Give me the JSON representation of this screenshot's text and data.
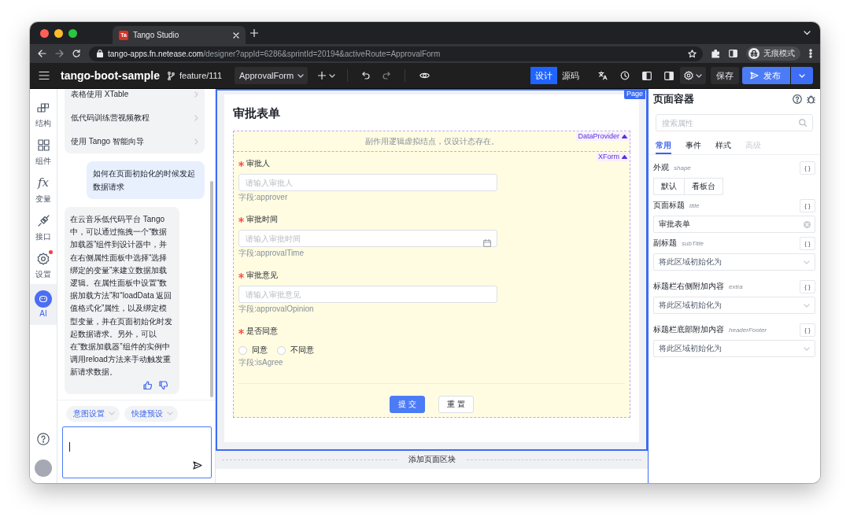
{
  "browser": {
    "favicon": "Ta",
    "tab_title": "Tango Studio",
    "url": "**tango-apps.fn.netease.com**/designer?appId=6286&sprintId=20194&activeRoute=ApprovalForm",
    "profile_label": "无痕模式"
  },
  "toolbar": {
    "project": "tango-boot-sample",
    "branch": "feature/111",
    "route": "ApprovalForm",
    "modes": [
      {
        "label": "设计",
        "selected": true
      },
      {
        "label": "源码",
        "selected": false
      }
    ],
    "save": "保存",
    "publish": "发布"
  },
  "rail": {
    "items": [
      {
        "kind": "structure",
        "label": "结构",
        "selected": false,
        "badge": false
      },
      {
        "kind": "components",
        "label": "组件",
        "selected": false,
        "badge": false
      },
      {
        "kind": "variables",
        "glyph": "fx",
        "label": "变量",
        "selected": false,
        "badge": false
      },
      {
        "kind": "api",
        "label": "接口",
        "selected": false,
        "badge": false
      },
      {
        "kind": "settings",
        "label": "设置",
        "selected": false,
        "badge": true
      },
      {
        "kind": "ai",
        "label": "AI",
        "selected": true,
        "badge": false
      }
    ]
  },
  "chat": {
    "guides": [
      {
        "label": "表格使用 XTable"
      },
      {
        "label": "低代码训练营视频教程"
      },
      {
        "label": "使用 Tango 智能向导"
      }
    ],
    "messages": [
      {
        "kind": "user",
        "text": "如何在页面初始化的时候发起数据请求"
      },
      {
        "kind": "assistant",
        "text": "在云音乐低代码平台 Tango 中，可以通过拖拽一个“数据加载器”组件到设计器中，并在右侧属性面板中选择“选择绑定的变量”来建立数据加载逻辑。在属性面板中设置“数据加载方法”和“loadData 返回值格式化”属性，以及绑定模型变量，并在页面初始化时发起数据请求。另外，可以在“数据加载器”组件的实例中调用reload方法来手动触发重新请求数据。"
      }
    ],
    "chips": [
      "意图设置",
      "快捷预设"
    ]
  },
  "canvas": {
    "page_tag": "Page",
    "title": "审批表单",
    "data_provider": {
      "tag": "DataProvider",
      "text": "副作用逻辑虚拟结点，仅设计态存在。"
    },
    "form": {
      "tag": "XForm",
      "fields": [
        {
          "kind": "input",
          "label": "审批人",
          "required": true,
          "placeholder": "请输入审批人",
          "hint": "字段:approver"
        },
        {
          "kind": "date",
          "label": "审批时间",
          "required": true,
          "placeholder": "请输入审批时间",
          "hint": "字段:approvalTime"
        },
        {
          "kind": "input",
          "label": "审批意见",
          "required": true,
          "placeholder": "请输入审批意见",
          "hint": "字段:approvalOpinion"
        },
        {
          "kind": "radio",
          "label": "是否同意",
          "required": true,
          "options": [
            {
              "label": "同意",
              "selected": false
            },
            {
              "label": "不同意",
              "selected": false
            }
          ],
          "hint": "字段:isAgree"
        }
      ],
      "buttons": [
        {
          "kind": "primary",
          "label": "提 交"
        },
        {
          "kind": "default",
          "label": "重 置"
        }
      ]
    },
    "add_block": "添加页面区块"
  },
  "inspector": {
    "title": "页面容器",
    "search_placeholder": "搜索属性",
    "tabs": [
      {
        "label": "常用",
        "selected": true,
        "disabled": false
      },
      {
        "label": "事件",
        "selected": false,
        "disabled": false
      },
      {
        "label": "样式",
        "selected": false,
        "disabled": false
      },
      {
        "label": "高级",
        "selected": false,
        "disabled": true
      }
    ],
    "props": [
      {
        "kind": "segmented",
        "label": "外观",
        "key": "shape",
        "binding": "{ }",
        "options": [
          {
            "label": "默认",
            "selected": false
          },
          {
            "label": "看板台",
            "selected": false
          }
        ]
      },
      {
        "kind": "input",
        "label": "页面标题",
        "key": "title",
        "binding": "{ }",
        "value": "审批表单"
      },
      {
        "kind": "select",
        "label": "副标题",
        "key": "subTitle",
        "binding": "{ }",
        "value": "将此区域初始化为"
      },
      {
        "kind": "select",
        "label": "标题栏右侧附加内容",
        "key": "extra",
        "binding": "{ }",
        "value": "将此区域初始化为"
      },
      {
        "kind": "select",
        "label": "标题栏底部附加内容",
        "key": "headerFooter",
        "binding": "{ }",
        "value": "将此区域初始化为"
      }
    ]
  }
}
